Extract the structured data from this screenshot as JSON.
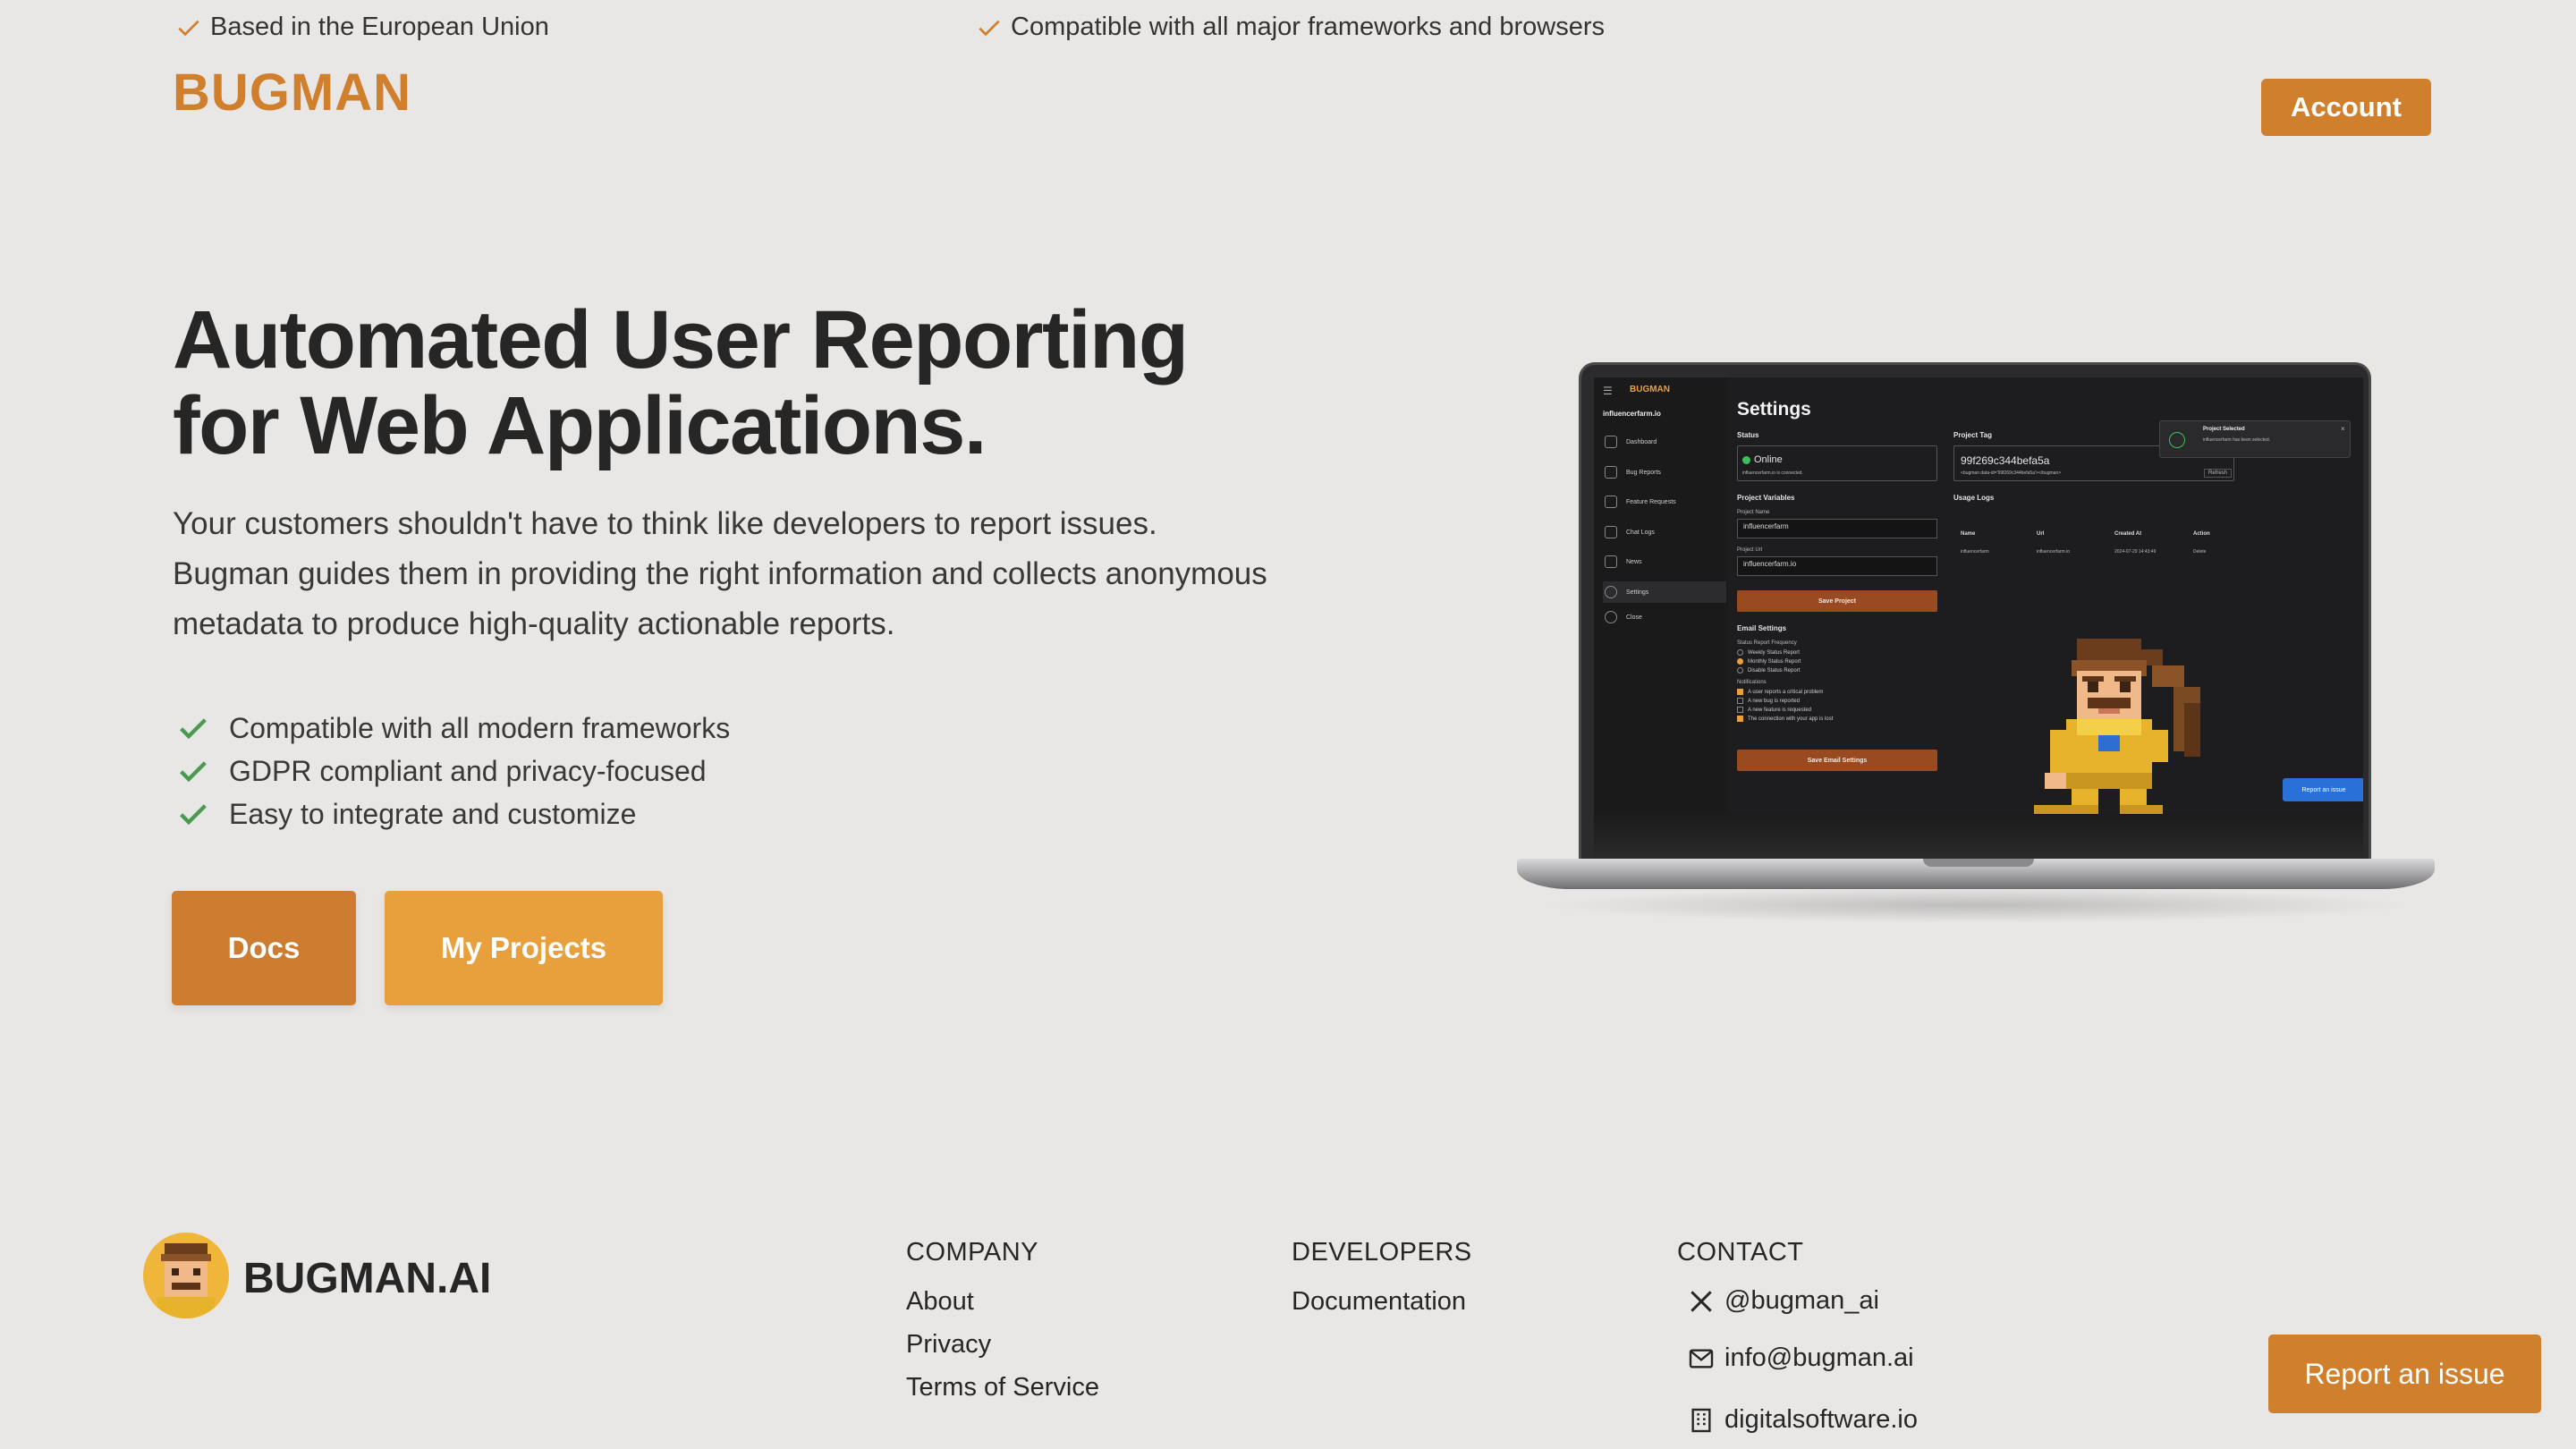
{
  "topbar": {
    "note_left": "Based in the European Union",
    "note_right": "Compatible with all major frameworks and browsers",
    "logo": "BUGMAN",
    "account_label": "Account"
  },
  "hero": {
    "title_line1": "Automated User Reporting",
    "title_line2": "for Web Applications.",
    "description": "Your customers shouldn't have to think like developers to report issues. Bugman guides them in providing the right information and collects anonymous metadata to produce high-quality actionable reports.",
    "features": [
      "Compatible with all modern frameworks",
      "GDPR compliant and privacy-focused",
      "Easy to integrate and customize"
    ],
    "docs_label": "Docs",
    "projects_label": "My Projects"
  },
  "screenshot": {
    "brand": "BUGMAN",
    "project": "influencerfarm.io",
    "nav": [
      "Dashboard",
      "Bug Reports",
      "Feature Requests",
      "Chat Logs",
      "News",
      "Settings",
      "Close"
    ],
    "title": "Settings",
    "status_label": "Status",
    "status_value": "Online",
    "status_sub": "influencerfarm.io is connected.",
    "project_tag_label": "Project Tag",
    "project_tag_value": "99f269c344befa5a",
    "project_tag_snippet": "<bugman data-id='99f269c344befa5a'></bugman>",
    "refresh_label": "Refresh",
    "variables_label": "Project Variables",
    "name_label": "Project Name",
    "name_value": "influencerfarm",
    "url_label": "Project Url",
    "url_value": "influencerfarm.io",
    "save_project": "Save Project",
    "usage_logs": "Usage Logs",
    "log_headers": [
      "Name",
      "Url",
      "Created At",
      "Action"
    ],
    "log_row": [
      "influencerfarm",
      "influencerfarm.io",
      "2024-07-29 14:43:49",
      "Delete"
    ],
    "email_settings": "Email Settings",
    "frequency_label": "Status Report Frequency",
    "frequency_options": [
      "Weekly Status Report",
      "Monthly Status Report",
      "Disable Status Report"
    ],
    "notifications_label": "Notifications",
    "notification_options": [
      "A user reports a critical problem",
      "A new bug is reported",
      "A new feature is requested",
      "The connection with your app is lost"
    ],
    "save_email": "Save Email Settings",
    "toast_title": "Project Selected",
    "toast_body": "influencerfarm has been selected.",
    "report_label": "Report an issue"
  },
  "footer": {
    "brand": "BUGMAN.AI",
    "company_heading": "COMPANY",
    "company_links": [
      "About",
      "Privacy",
      "Terms of Service"
    ],
    "developers_heading": "DEVELOPERS",
    "developers_links": [
      "Documentation"
    ],
    "contact_heading": "CONTACT",
    "contact_x": "@bugman_ai",
    "contact_email": "info@bugman.ai",
    "contact_site": "digitalsoftware.io"
  },
  "report_button": "Report an issue",
  "colors": {
    "accent": "#d07f2c",
    "accent_light": "#e8a03c",
    "check_green": "#4a9a52",
    "background": "#e8e7e6"
  },
  "icons": [
    "check-icon",
    "x-logo-icon",
    "mail-icon",
    "building-icon"
  ]
}
